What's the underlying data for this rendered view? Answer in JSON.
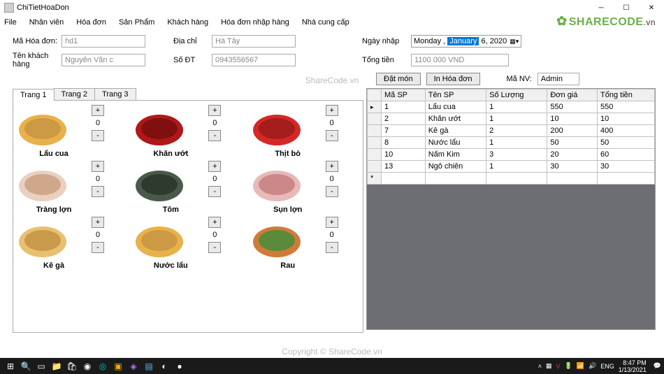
{
  "window": {
    "title": "ChiTietHoaDon"
  },
  "menu": [
    "File",
    "Nhân viên",
    "Hóa đơn",
    "Sản Phẩm",
    "Khách hàng",
    "Hóa đơn nhập hàng",
    "Nhà cung cấp"
  ],
  "watermarks": {
    "logo_main": "SHARECODE",
    "logo_suffix": ".vn",
    "center": "ShareCode.vn",
    "footer": "Copyright © ShareCode.vn"
  },
  "form": {
    "ma_hoa_don_label": "Mã Hóa đơn:",
    "ma_hoa_don": "hd1",
    "ten_kh_label": "Tên khách hàng",
    "ten_kh": "Nguyễn Văn c",
    "dia_chi_label": "Địa chỉ",
    "dia_chi": "Hà Tây",
    "so_dt_label": "Số ĐT",
    "so_dt": "0943556567",
    "ngay_nhap_label": "Ngày nhập",
    "date_weekday": "Monday",
    "date_month": "January",
    "date_day": "6,",
    "date_year": "2020",
    "tong_tien_label": "Tổng tiền",
    "tong_tien": "1100 000 VND",
    "manv_label": "Mã NV:",
    "manv": "Admin"
  },
  "buttons": {
    "dat_mon": "Đặt món",
    "in_hoa_don": "In Hóa đơn"
  },
  "tabs": [
    {
      "label": "Trang 1",
      "active": true
    },
    {
      "label": "Trang 2",
      "active": false
    },
    {
      "label": "Trang 3",
      "active": false
    }
  ],
  "foods": [
    {
      "name": "Lẩu cua",
      "qty": "0"
    },
    {
      "name": "Khăn ướt",
      "qty": "0"
    },
    {
      "name": "Thịt bò",
      "qty": "0"
    },
    {
      "name": "Tràng lợn",
      "qty": "0"
    },
    {
      "name": "Tôm",
      "qty": "0"
    },
    {
      "name": "Sụn lợn",
      "qty": "0"
    },
    {
      "name": "Kê gà",
      "qty": "0"
    },
    {
      "name": "Nước lẩu",
      "qty": "0"
    },
    {
      "name": "Rau",
      "qty": "0"
    }
  ],
  "grid": {
    "headers": [
      "Mã SP",
      "Tên SP",
      "Số Lượng",
      "Đơn giá",
      "Tổng tiền"
    ],
    "rows": [
      [
        "1",
        "Lẩu cua",
        "1",
        "550",
        "550"
      ],
      [
        "2",
        "Khăn ướt",
        "1",
        "10",
        "10"
      ],
      [
        "7",
        "Kê gà",
        "2",
        "200",
        "400"
      ],
      [
        "8",
        "Nước lẩu",
        "1",
        "50",
        "50"
      ],
      [
        "10",
        "Nấm Kim",
        "3",
        "20",
        "60"
      ],
      [
        "13",
        "Ngô chiên",
        "1",
        "30",
        "30"
      ]
    ]
  },
  "taskbar": {
    "tray_lang": "ENG",
    "time": "8:47 PM",
    "date": "1/13/2021"
  }
}
